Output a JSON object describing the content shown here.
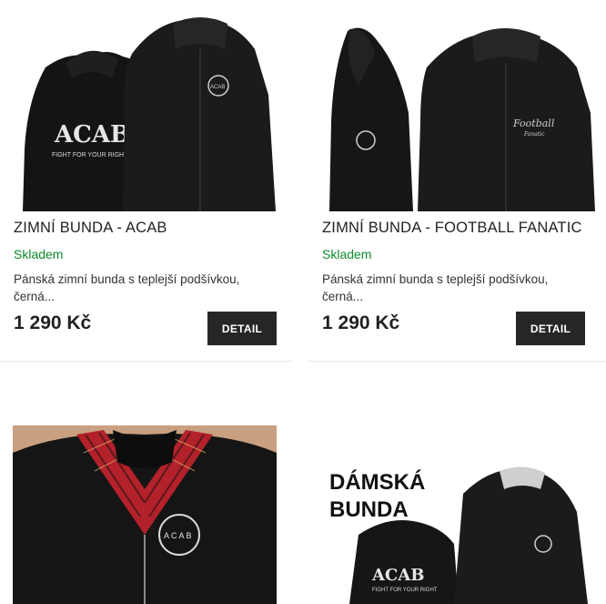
{
  "products": [
    {
      "title": "ZIMNÍ BUNDA - ACAB",
      "stock": "Skladem",
      "description": "Pánská zimní bunda s teplejší podšívkou, černá...",
      "price": "1 290 Kč",
      "button": "DETAIL",
      "image_text": {
        "back_print": "ACAB",
        "back_subtitle": "FIGHT FOR YOUR RIGHT",
        "chest_logo": "ACAB"
      }
    },
    {
      "title": "ZIMNÍ BUNDA - FOOTBALL FANATIC",
      "stock": "Skladem",
      "description": "Pánská zimní bunda s teplejší podšívkou, černá...",
      "price": "1 290 Kč",
      "button": "DETAIL",
      "image_text": {
        "chest_script": "Football",
        "chest_script_sub": "Fanatic"
      }
    },
    {
      "image_text": {
        "logo_letters": "A C A B"
      }
    },
    {
      "image_text": {
        "headline_1": "DÁMSKÁ",
        "headline_2": "BUNDA",
        "back_print": "ACAB",
        "back_subtitle": "FIGHT FOR YOUR RIGHT"
      }
    }
  ],
  "colors": {
    "stock_green": "#0c8a2b",
    "button_bg": "#262626",
    "divider": "#e5e5e5"
  }
}
